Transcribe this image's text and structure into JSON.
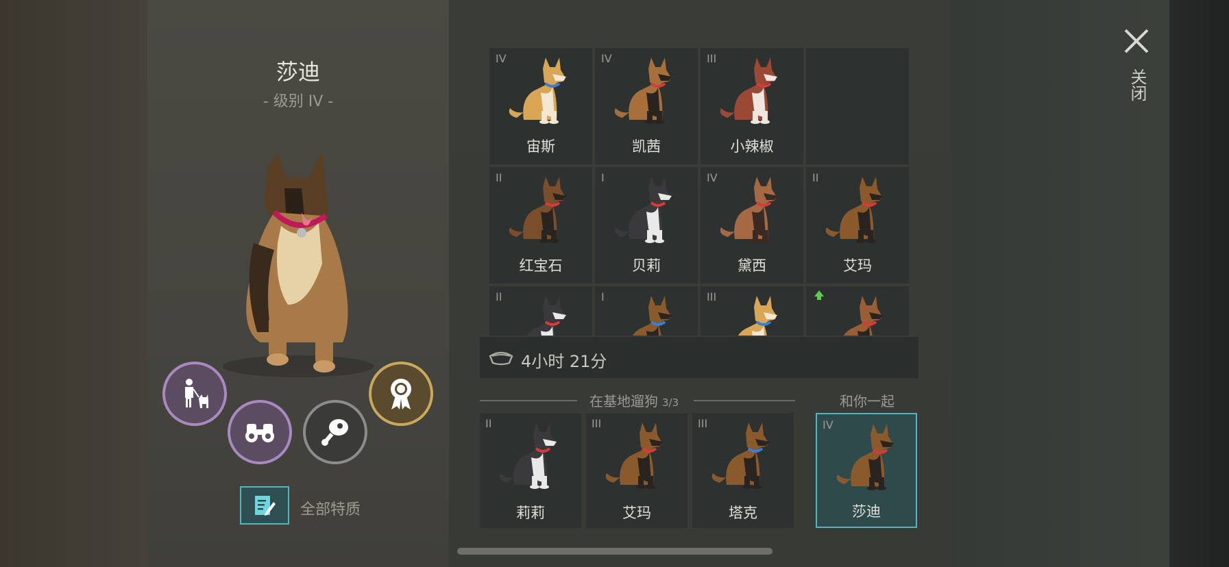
{
  "selected_dog": {
    "name": "莎迪",
    "level": "- 级别 IV -"
  },
  "actions": {
    "walk_icon": "person-with-dog-icon",
    "explore_icon": "binoculars-icon",
    "feed_icon": "meat-icon",
    "award_icon": "medal-icon",
    "traits_label": "全部特质"
  },
  "grid": [
    {
      "level": "IV",
      "name": "宙斯",
      "fur": "#d9a656",
      "fur2": "#f3e7d2",
      "collar": "#3a7fd6"
    },
    {
      "level": "IV",
      "name": "凯茜",
      "fur": "#a7703a",
      "fur2": "#2a2420",
      "collar": "#d63a3a"
    },
    {
      "level": "III",
      "name": "小辣椒",
      "fur": "#9a4a34",
      "fur2": "#efe7df",
      "collar": "#d63a3a"
    },
    {
      "level": "",
      "name": "",
      "empty": true
    },
    {
      "level": "II",
      "name": "红宝石",
      "fur": "#7a4e2a",
      "fur2": "#2a2420",
      "collar": "#d63a3a"
    },
    {
      "level": "I",
      "name": "贝莉",
      "fur": "#3a3a3c",
      "fur2": "#e9e9ea",
      "collar": "#d63a3a"
    },
    {
      "level": "IV",
      "name": "黛西",
      "fur": "#a56a44",
      "fur2": "#3a2a22",
      "collar": "#d63a3a"
    },
    {
      "level": "II",
      "name": "艾玛",
      "fur": "#8a5a2c",
      "fur2": "#2a2420",
      "collar": "#d63a3a"
    },
    {
      "level": "II",
      "name": "",
      "fur": "#3a3a3c",
      "fur2": "#e9e9ea",
      "collar": "#d63a3a"
    },
    {
      "level": "I",
      "name": "",
      "fur": "#8a5a2c",
      "fur2": "#2a2420",
      "collar": "#3a7fd6"
    },
    {
      "level": "III",
      "name": "",
      "fur": "#d9a656",
      "fur2": "#f3e7d2",
      "collar": "#3a7fd6"
    },
    {
      "level": "",
      "name": "",
      "upgrade": true,
      "fur": "#9a5e36",
      "fur2": "#2a2420",
      "collar": "#d63a3a"
    }
  ],
  "timer": {
    "icon": "food-bowl-icon",
    "text": "4小时 21分"
  },
  "walking": {
    "title": "在基地遛狗",
    "count": "3/3",
    "dogs": [
      {
        "level": "II",
        "name": "莉莉",
        "fur": "#3a3a3c",
        "fur2": "#e9e9ea",
        "collar": "#d63a3a"
      },
      {
        "level": "III",
        "name": "艾玛",
        "fur": "#8a5a2c",
        "fur2": "#2a2420",
        "collar": "#d63a3a"
      },
      {
        "level": "III",
        "name": "塔克",
        "fur": "#8a5a2c",
        "fur2": "#2a2420",
        "collar": "#3a7fd6"
      }
    ]
  },
  "with_you": {
    "title": "和你一起",
    "dog": {
      "level": "IV",
      "name": "莎迪",
      "fur": "#8a5a2c",
      "fur2": "#2a2420",
      "collar": "#d63a3a"
    }
  },
  "close": {
    "label": "关闭",
    "icon": "close-icon"
  },
  "colors": {
    "accent": "#4fb6c2",
    "purple_ring": "#a98ac0",
    "gold_ring": "#c9a95c",
    "upgrade": "#5ecb4f"
  }
}
